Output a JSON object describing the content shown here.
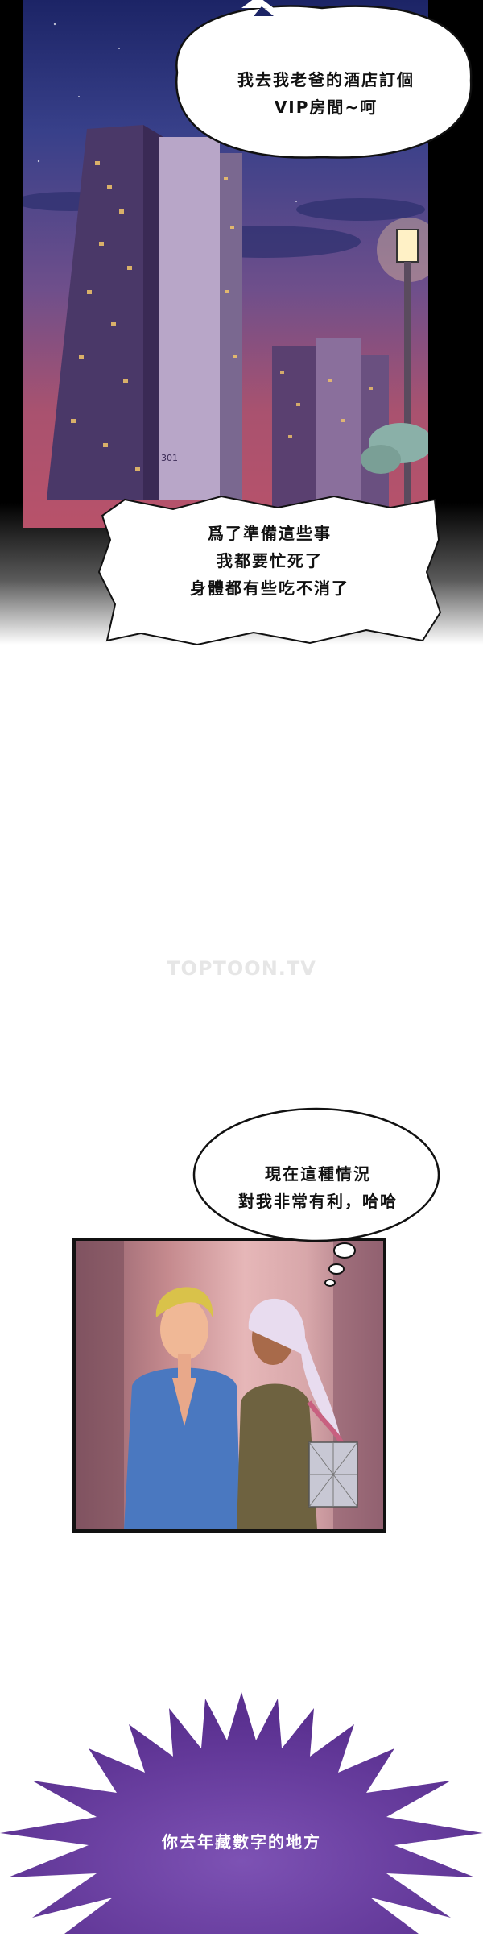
{
  "panels": {
    "city": {
      "speech_bubble": {
        "line1": "我去我老爸的酒店訂個",
        "line2": "VIP房間~呵"
      },
      "caption_box": {
        "line1": "爲了準備這些事",
        "line2": "我都要忙死了",
        "line3": "身體都有些吃不消了"
      },
      "building_number": "301"
    },
    "couple": {
      "thought_bubble": {
        "line1": "現在這種情況",
        "line2": "對我非常有利，哈哈"
      }
    },
    "burst": {
      "text": "你去年藏數字的地方"
    }
  },
  "watermark": "TOPTOON.TV",
  "colors": {
    "sky_top": "#1c2466",
    "sky_bottom": "#b8526a",
    "burst_purple": "#6a3fa0",
    "hair_blond": "#d9c24a",
    "hair_silver": "#e8dcef",
    "shirt_blue": "#4a78c0"
  }
}
